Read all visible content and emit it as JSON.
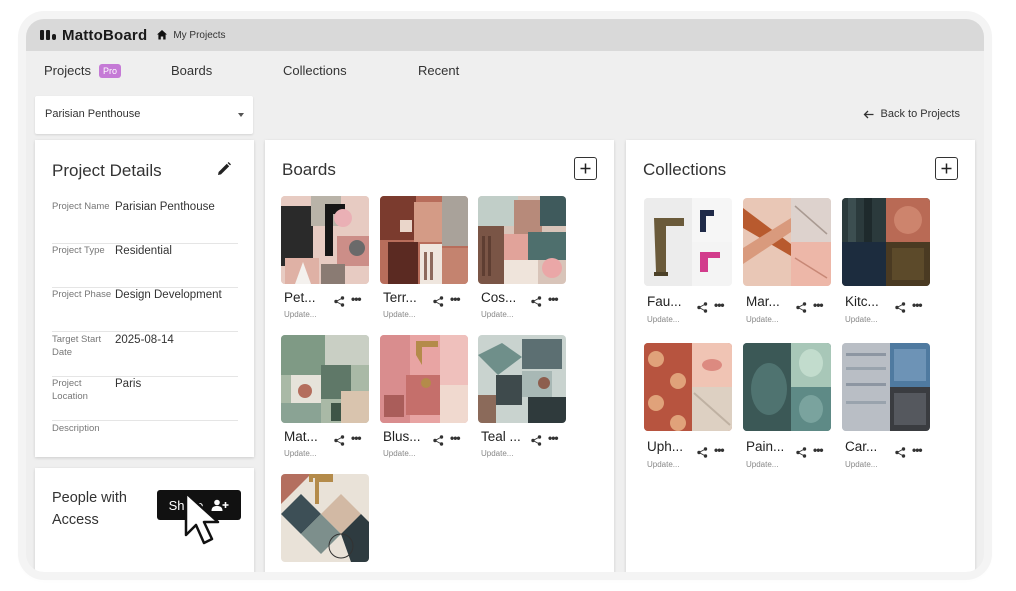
{
  "app": {
    "logo_text": "MattoBoard",
    "breadcrumb": "My Projects",
    "logo_icon": "mattoboard-logo-icon"
  },
  "nav": {
    "projects_label": "Projects",
    "pro_badge": "Pro",
    "boards_label": "Boards",
    "collections_label": "Collections",
    "recent_label": "Recent"
  },
  "project_select": {
    "value": "Parisian Penthouse"
  },
  "back_link": {
    "label": "Back to Projects",
    "icon": "arrow-left-icon"
  },
  "details": {
    "title": "Project Details",
    "rows": [
      {
        "label": "Project Name",
        "value": "Parisian Penthouse"
      },
      {
        "label": "Project Type",
        "value": "Residential"
      },
      {
        "label": "Project Phase",
        "value": "Design Development"
      },
      {
        "label": "Target Start Date",
        "value": "2025-08-14"
      },
      {
        "label": "Project Location",
        "value": "Paris"
      },
      {
        "label": "Description",
        "value": ""
      }
    ]
  },
  "people": {
    "title": "People with Access",
    "share_label": "Share"
  },
  "boards": {
    "title": "Boards",
    "items": [
      {
        "name": "Pet...",
        "updated": "Update..."
      },
      {
        "name": "Terr...",
        "updated": "Update..."
      },
      {
        "name": "Cos...",
        "updated": "Update..."
      },
      {
        "name": "Mat...",
        "updated": "Update..."
      },
      {
        "name": "Blus...",
        "updated": "Update..."
      },
      {
        "name": "Teal ...",
        "updated": "Update..."
      },
      {
        "name": "",
        "updated": ""
      }
    ]
  },
  "collections": {
    "title": "Collections",
    "items": [
      {
        "name": "Fau...",
        "updated": "Update..."
      },
      {
        "name": "Mar...",
        "updated": "Update..."
      },
      {
        "name": "Kitc...",
        "updated": "Update..."
      },
      {
        "name": "Uph...",
        "updated": "Update..."
      },
      {
        "name": "Pain...",
        "updated": "Update..."
      },
      {
        "name": "Car...",
        "updated": "Update..."
      }
    ]
  },
  "colors": {
    "pro_badge": "#c57ad6",
    "share_button": "#111111",
    "frame_bg": "#efefef",
    "titlebar": "#d9d9d9"
  }
}
